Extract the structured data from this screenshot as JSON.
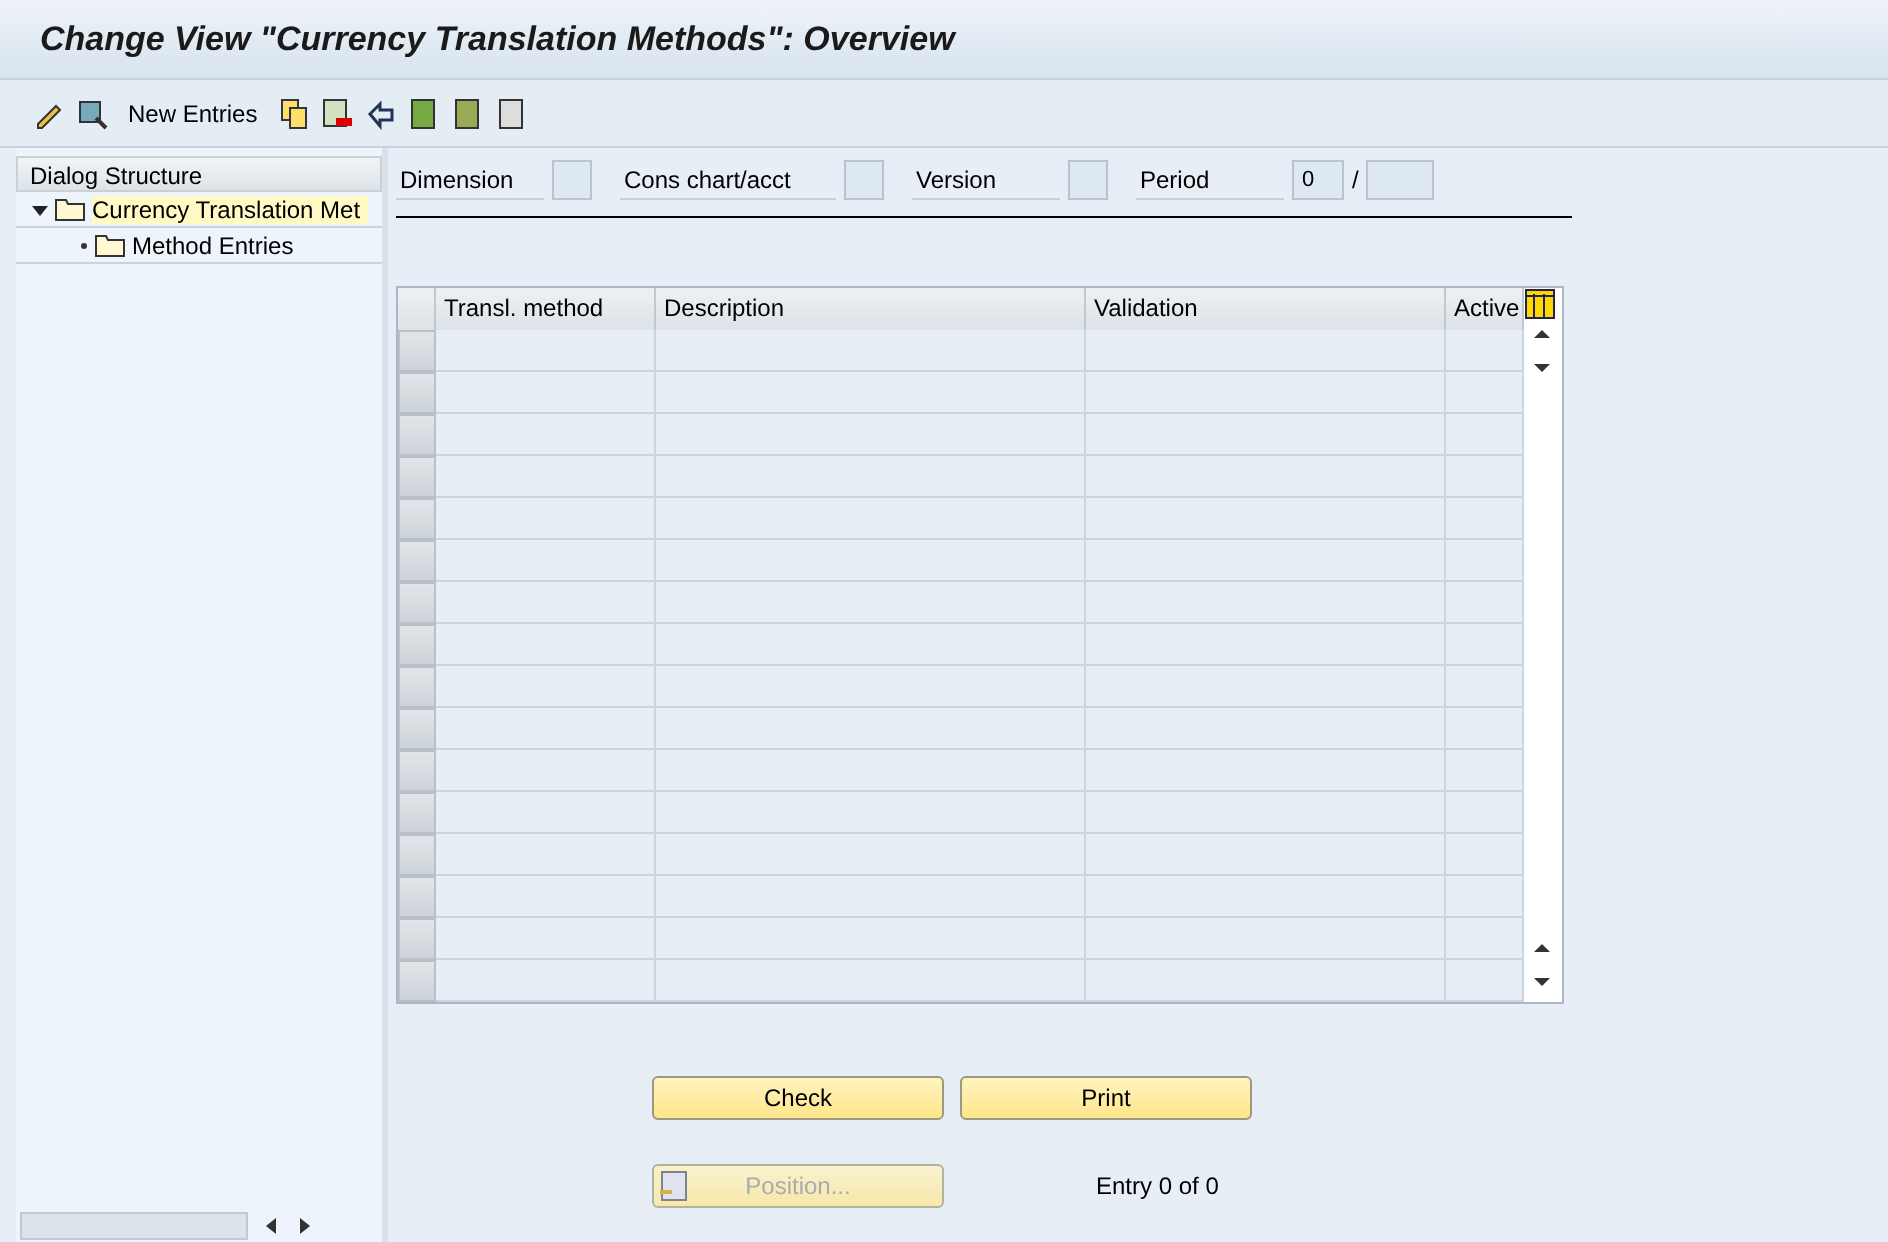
{
  "window": {
    "title": "Change View \"Currency Translation Methods\": Overview"
  },
  "toolbar": {
    "new_entries": "New Entries"
  },
  "dialog_structure": {
    "title": "Dialog Structure",
    "items": [
      {
        "label": "Currency Translation Met",
        "selected": true,
        "expanded": true,
        "children": [
          {
            "label": "Method Entries",
            "selected": false
          }
        ]
      }
    ]
  },
  "header_fields": [
    {
      "label": "Dimension"
    },
    {
      "label": "Cons chart/acct"
    },
    {
      "label": "Version"
    },
    {
      "label": "Period",
      "value": "0",
      "separator": "/"
    }
  ],
  "table": {
    "columns": [
      "Transl. method",
      "Description",
      "Validation",
      "Active"
    ]
  },
  "buttons": [
    {
      "label": "Check",
      "disabled": false
    },
    {
      "label": "Print",
      "disabled": false
    }
  ],
  "position_button": {
    "label": "Position...",
    "disabled": true
  },
  "entry_count": "Entry 0 of 0"
}
